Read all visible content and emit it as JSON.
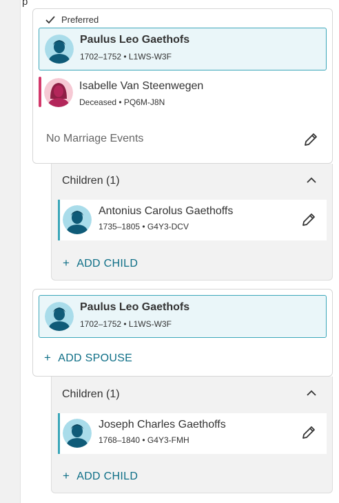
{
  "top_fragment": "p",
  "families": [
    {
      "preferred_label": "Preferred",
      "focus_person": {
        "name": "Paulus Leo Gaethofs",
        "meta": "1702–1752 • L1WS-W3F"
      },
      "spouse": {
        "name": "Isabelle Van Steenwegen",
        "meta": "Deceased • PQ6M-J8N"
      },
      "marriage_text": "No Marriage Events",
      "children_header": "Children (1)",
      "children": [
        {
          "name": "Antonius Carolus Gaethoffs",
          "meta": "1735–1805 • G4Y3-DCV"
        }
      ],
      "add_child_label": "ADD CHILD"
    },
    {
      "focus_person": {
        "name": "Paulus Leo Gaethofs",
        "meta": "1702–1752 • L1WS-W3F"
      },
      "add_spouse_label": "ADD SPOUSE",
      "children_header": "Children (1)",
      "children": [
        {
          "name": "Joseph Charles Gaethoffs",
          "meta": "1768–1840 • G4Y3-FMH"
        }
      ],
      "add_child_label": "ADD CHILD"
    }
  ],
  "icons": {
    "check": "check-icon",
    "edit": "pencil-icon",
    "collapse": "chevron-up-icon",
    "male_avatar": "male-avatar-icon",
    "female_avatar": "female-avatar-icon"
  },
  "colors": {
    "accent_teal": "#3aa6b9",
    "link": "#0d6e86",
    "female_bar": "#d3396b",
    "focus_bg": "#eaf6f9"
  }
}
